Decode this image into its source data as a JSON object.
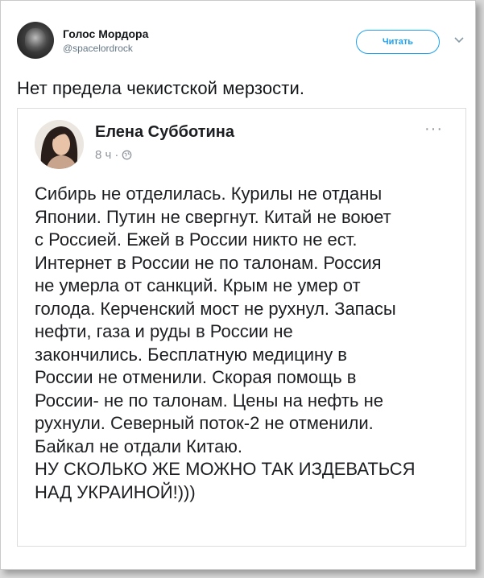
{
  "tweet": {
    "author_name": "Голос Мордора",
    "author_handle": "@spacelordrock",
    "follow_label": "Читать",
    "text": "Нет предела чекистской мерзости."
  },
  "embedded_post": {
    "author_name": "Елена Субботина",
    "time": "8 ч",
    "separator": "·",
    "more_label": "···",
    "lines": [
      "Сибирь не отделилась. Курилы не отданы",
      "Японии. Путин не свергнут. Китай не воюет",
      "с Россией. Ежей в России никто не ест.",
      "Интернет в России не по талонам. Россия",
      "не умерла от санкций. Крым не умер от",
      "голода. Керченский мост не рухнул. Запасы",
      "нефти, газа и руды в России не",
      "закончились. Бесплатную медицину в",
      "России не отменили. Скорая помощь в",
      "России- не по талонам. Цены на нефть не",
      "рухнули. Северный поток-2 не отменили.",
      "Байкал не отдали Китаю.",
      "НУ СКОЛЬКО ЖЕ МОЖНО ТАК ИЗДЕВАТЬСЯ",
      "НАД УКРАИНОЙ!)))"
    ]
  },
  "icons": {
    "caret": "chevron-down-icon",
    "audience": "globe-icon"
  },
  "colors": {
    "accent": "#1da1f2",
    "text": "#14171a",
    "muted": "#657786",
    "fb_muted": "#90949c"
  }
}
